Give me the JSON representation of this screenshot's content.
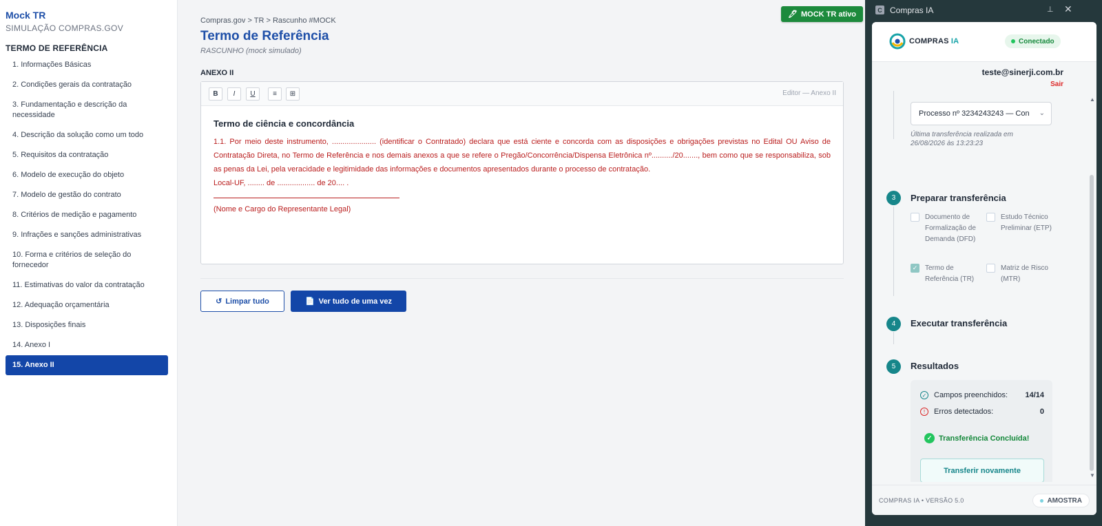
{
  "sidebar": {
    "brand": "Mock TR",
    "brand_sub": "SIMULAÇÃO COMPRAS.GOV",
    "section_title": "TERMO DE REFERÊNCIA",
    "items": [
      {
        "label": "1. Informações Básicas"
      },
      {
        "label": "2. Condições gerais da contratação"
      },
      {
        "label": "3. Fundamentação e descrição da necessidade"
      },
      {
        "label": "4. Descrição da solução como um todo"
      },
      {
        "label": "5. Requisitos da contratação"
      },
      {
        "label": "6. Modelo de execução do objeto"
      },
      {
        "label": "7. Modelo de gestão do contrato"
      },
      {
        "label": "8. Critérios de medição e pagamento"
      },
      {
        "label": "9. Infrações e sanções administrativas"
      },
      {
        "label": "10. Forma e critérios de seleção do fornecedor"
      },
      {
        "label": "11. Estimativas do valor da contratação"
      },
      {
        "label": "12. Adequação orçamentária"
      },
      {
        "label": "13. Disposições finais"
      },
      {
        "label": "14. Anexo I"
      },
      {
        "label": "15. Anexo II",
        "active": true
      }
    ]
  },
  "main": {
    "breadcrumb": "Compras.gov > TR > Rascunho #MOCK",
    "title": "Termo de Referência",
    "subtitle": "RASCUNHO (mock simulado)",
    "mock_badge": "MOCK TR ativo",
    "mock_badge_icon": "pencil-icon",
    "annex_label": "ANEXO II",
    "editor": {
      "toolbar": {
        "bold": "B",
        "italic": "I",
        "underline": "U",
        "list": "≡",
        "table": "⊞"
      },
      "label": "Editor — Anexo II",
      "heading": "Termo de ciência e concordância",
      "paragraph": "1.1. Por meio deste instrumento, ..................... (identificar o Contratado) declara que está ciente e concorda com as disposições e obrigações previstas no Edital OU Aviso de Contratação Direta, no Termo de Referência e nos demais anexos a que se refere o Pregão/Concorrência/Dispensa Eletrônica nº........../20......., bem como que se responsabiliza, sob as penas da Lei, pela veracidade e legitimidade das informações e documentos apresentados durante o processo de contratação.",
      "place_date": "Local-UF, ........ de .................. de 20.... .",
      "signature": "(Nome e Cargo do Representante Legal)"
    },
    "buttons": {
      "clear_icon": "↺",
      "clear": "Limpar tudo",
      "view_icon": "📄",
      "view": "Ver tudo de uma vez"
    }
  },
  "panel": {
    "app_icon": "C",
    "app_title": "Compras IA",
    "logo_text_a": "COMPRAS",
    "logo_text_b": " IA",
    "status": "Conectado",
    "email": "teste@sinerji.com.br",
    "logout": "Sair",
    "process_select": "Processo nº 3234243243 — Con",
    "last_transfer": "Última transferência realizada em 26/08/2026 às 13:23:23",
    "steps": [
      {
        "num": "3",
        "title": "Preparar transferência"
      },
      {
        "num": "4",
        "title": "Executar transferência"
      },
      {
        "num": "5",
        "title": "Resultados"
      }
    ],
    "docs": [
      {
        "label": "Documento de Formalização de Demanda (DFD)",
        "checked": false
      },
      {
        "label": "Estudo Técnico Preliminar (ETP)",
        "checked": false
      },
      {
        "label": "Termo de Referência (TR)",
        "checked": true
      },
      {
        "label": "Matriz de Risco (MTR)",
        "checked": false
      }
    ],
    "results": {
      "filled_label": "Campos preenchidos:",
      "filled_value": "14/14",
      "errors_label": "Erros detectados:",
      "errors_value": "0",
      "success": "Transferência Concluída!",
      "retry": "Transferir novamente"
    },
    "footer_version": "COMPRAS IA • VERSÃO 5.0",
    "footer_pill": "AMOSTRA"
  }
}
